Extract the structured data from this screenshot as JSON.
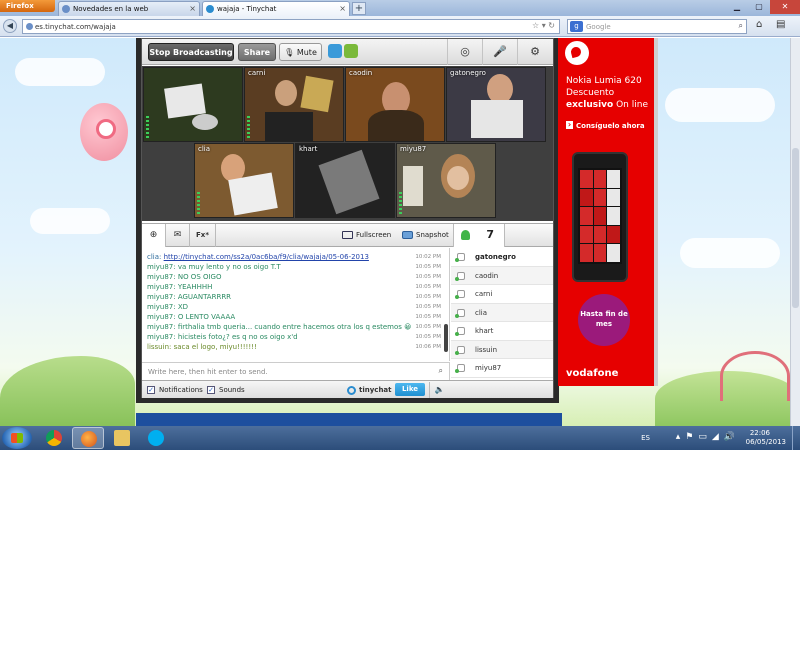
{
  "browser": {
    "menu_button": "Firefox",
    "tabs": [
      {
        "title": "Novedades en la web"
      },
      {
        "title": "wajaja - Tinychat"
      }
    ],
    "url": "es.tinychat.com/wajaja",
    "search_placeholder": "Google"
  },
  "tinychat": {
    "toolbar": {
      "stop_broadcasting": "Stop Broadcasting",
      "share": "Share",
      "mute": "Mute"
    },
    "cameras": [
      {
        "name": "",
        "bg": "#2d3a1f"
      },
      {
        "name": "carni",
        "bg": "#5a3d22"
      },
      {
        "name": "caodin",
        "bg": "#7a4a1e"
      },
      {
        "name": "gatonegro",
        "bg": "#3c3a45"
      },
      {
        "name": "clia",
        "bg": "#7d5a30"
      },
      {
        "name": "khart",
        "bg": "#222222"
      },
      {
        "name": "miyu87",
        "bg": "#5f5a4a"
      }
    ],
    "chat_toolbar": {
      "fx": "Fx*",
      "fullscreen": "Fullscreen",
      "snapshot": "Snapshot",
      "user_count": "7"
    },
    "messages": [
      {
        "text": "clia: ",
        "link": "http://tinychat.com/ss2a/0ac6ba/f9/clia/wajaja/05-06-2013",
        "time": "10:02 PM",
        "who": "clia"
      },
      {
        "text": "miyu87: va muy lento y no os oigo T.T",
        "time": "10:05 PM",
        "who": "miyu"
      },
      {
        "text": "miyu87: NO OS OIGO",
        "time": "10:05 PM",
        "who": "miyu"
      },
      {
        "text": "miyu87: YEAHHHH",
        "time": "10:05 PM",
        "who": "miyu"
      },
      {
        "text": "miyu87: AGUANTARRRR",
        "time": "10:05 PM",
        "who": "miyu"
      },
      {
        "text": "miyu87: XD",
        "time": "10:05 PM",
        "who": "miyu"
      },
      {
        "text": "miyu87: O LENTO VAAAA",
        "time": "10:05 PM",
        "who": "miyu"
      },
      {
        "text": "miyu87: firthalia tmb queria... cuando entre hacemos otra los q estemos 😀",
        "time": "10:05 PM",
        "who": "miyu"
      },
      {
        "text": "miyu87: hicisteis foto¿? es q no os oigo x'd",
        "time": "10:05 PM",
        "who": "miyu"
      },
      {
        "text": "lissuin: saca el logo, miyu!!!!!!!",
        "time": "10:06 PM",
        "who": "lis"
      }
    ],
    "input_placeholder": "Write here, then hit enter to send.",
    "users": [
      "gatonegro",
      "caodin",
      "carni",
      "clia",
      "khart",
      "lissuin",
      "miyu87"
    ],
    "bottom": {
      "notifications": "Notifications",
      "sounds": "Sounds",
      "brand": "tinychat",
      "like": "Like"
    }
  },
  "ad": {
    "title": "Nokia Lumia 620",
    "line2": "Descuento",
    "line3_bold": "exclusivo",
    "line3_rest": " On line",
    "cta": "Consíguelo ahora",
    "badge": "Hasta fin de mes",
    "brand": "vodafone",
    "color": "#e60000"
  },
  "taskbar": {
    "language": "ES",
    "time": "22:06",
    "date": "06/05/2013"
  }
}
